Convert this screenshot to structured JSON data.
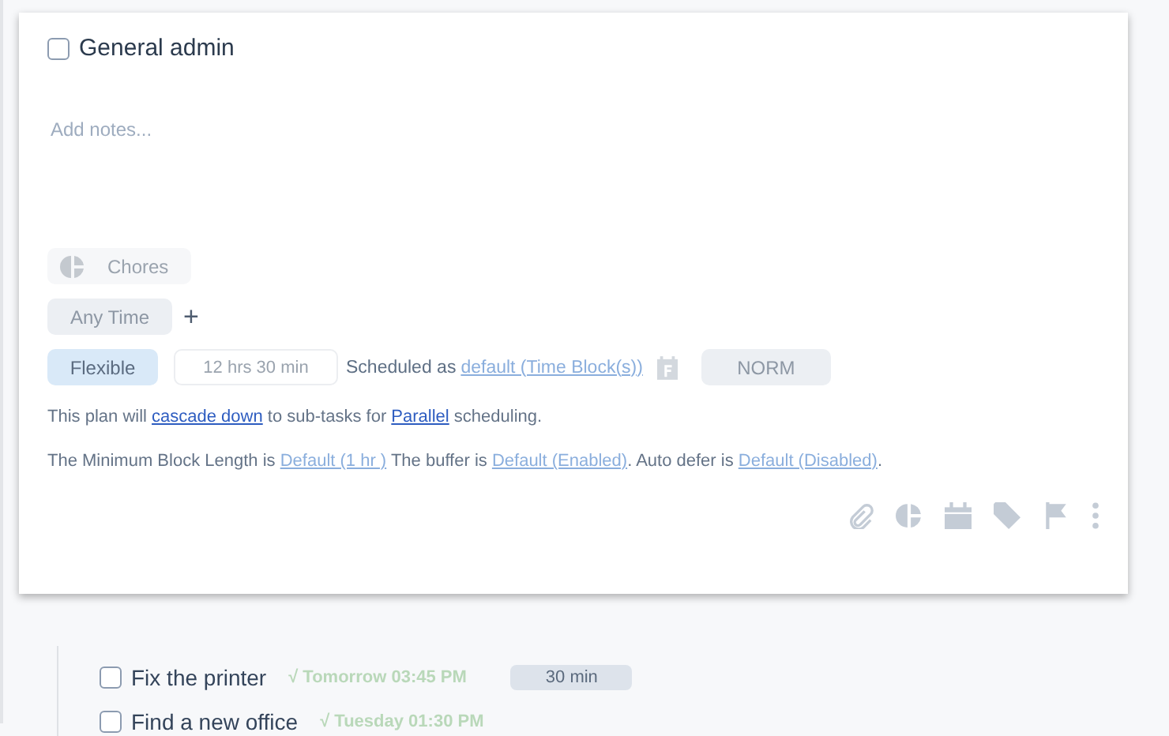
{
  "task": {
    "title": "General admin",
    "checked": false
  },
  "notes": {
    "placeholder": "Add notes..."
  },
  "category": {
    "label": "Chores"
  },
  "time_of_day": {
    "label": "Any Time"
  },
  "add_label": "+",
  "mode": {
    "label": "Flexible",
    "selected": true
  },
  "duration": {
    "placeholder": "12 hrs 30 min"
  },
  "scheduled": {
    "label": "Scheduled as",
    "link": "default (Time Block(s))"
  },
  "priority": {
    "label": "NORM"
  },
  "sentences": [
    [
      {
        "kind": "plain",
        "text": "This plan will "
      },
      {
        "kind": "link",
        "text": "cascade down"
      },
      {
        "kind": "plain",
        "text": " to sub-tasks for "
      },
      {
        "kind": "link",
        "text": "Parallel"
      },
      {
        "kind": "plain",
        "text": " scheduling."
      }
    ],
    [
      {
        "kind": "plain",
        "text": "The Minimum Block Length is "
      },
      {
        "kind": "faded",
        "text": "Default (1 hr )"
      },
      {
        "kind": "plain",
        "text": " The buffer is "
      },
      {
        "kind": "faded",
        "text": "Default (Enabled)"
      },
      {
        "kind": "plain",
        "text": ". Auto defer is "
      },
      {
        "kind": "faded",
        "text": "Default (Disabled)"
      },
      {
        "kind": "plain",
        "text": "."
      }
    ]
  ],
  "subtasks": [
    {
      "title": "Fix the printer",
      "checked": false,
      "due": "√ Tomorrow 03:45 PM",
      "duration": "30 min"
    },
    {
      "title": "Find a new office",
      "checked": false,
      "due": "√ Tuesday 01:30 PM"
    }
  ]
}
